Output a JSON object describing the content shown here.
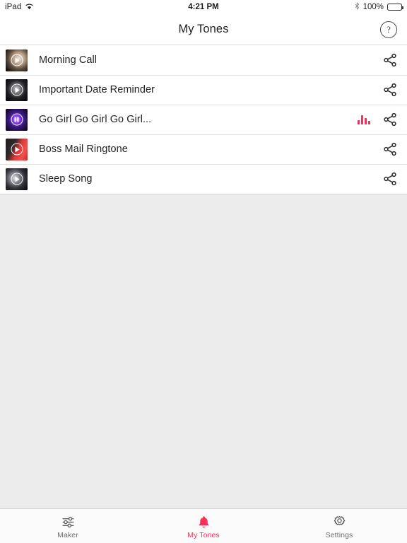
{
  "status_bar": {
    "device": "iPad",
    "wifi_icon": "wifi-icon",
    "time": "4:21 PM",
    "bluetooth_icon": "bluetooth-icon",
    "battery_percent": "100%",
    "battery_icon": "battery-full-icon"
  },
  "nav_bar": {
    "title": "My Tones",
    "help_label": "?",
    "help_icon": "question-mark-circle-icon"
  },
  "colors": {
    "accent": "#f8315a",
    "background": "#ececec",
    "surface": "#ffffff",
    "text": "#232323",
    "muted_text": "#6d6d6d",
    "separator": "#e2e2e2"
  },
  "tones": [
    {
      "title": "Morning Call",
      "thumb_name": "tone-artwork-morning-call",
      "state": "paused",
      "play_icon": "play-icon",
      "playing": false,
      "share_icon": "share-icon",
      "art_a": "#8b7f72",
      "art_b": "#1b1713"
    },
    {
      "title": "Important Date Reminder",
      "thumb_name": "tone-artwork-important-date-reminder",
      "state": "paused",
      "play_icon": "play-icon",
      "playing": false,
      "share_icon": "share-icon",
      "art_a": "#6f6f73",
      "art_b": "#0d0d0f"
    },
    {
      "title": "Go Girl Go Girl Go Girl...",
      "thumb_name": "tone-artwork-go-girl",
      "state": "playing",
      "play_icon": "pause-icon",
      "playing": true,
      "equalizer_icon": "equalizer-icon",
      "share_icon": "share-icon",
      "art_a": "#7a3bd6",
      "art_b": "#150a2e"
    },
    {
      "title": "Boss Mail Ringtone",
      "thumb_name": "tone-artwork-boss-mail-ringtone",
      "state": "paused",
      "play_icon": "play-icon",
      "playing": false,
      "share_icon": "share-icon",
      "art_a": "#e03535",
      "art_b": "#2a1110"
    },
    {
      "title": "Sleep Song",
      "thumb_name": "tone-artwork-sleep-song",
      "state": "paused",
      "play_icon": "play-icon",
      "playing": false,
      "share_icon": "share-icon",
      "art_a": "#9a9aa6",
      "art_b": "#131318"
    }
  ],
  "equalizer_bars": [
    6,
    13,
    9,
    5
  ],
  "tab_bar": {
    "items": [
      {
        "label": "Maker",
        "icon": "sliders-icon",
        "active": false
      },
      {
        "label": "My Tones",
        "icon": "bell-icon",
        "active": true
      },
      {
        "label": "Settings",
        "icon": "gear-icon",
        "active": false
      }
    ]
  }
}
